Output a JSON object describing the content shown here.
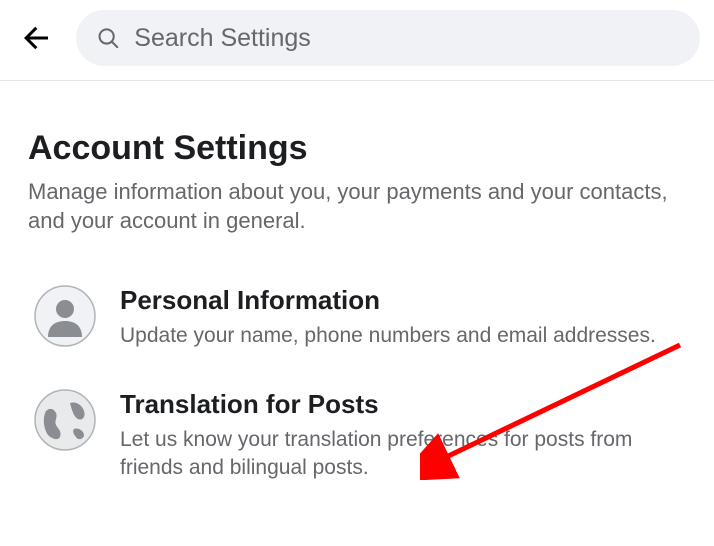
{
  "header": {
    "search_placeholder": "Search Settings"
  },
  "page": {
    "title": "Account Settings",
    "subtitle": "Manage information about you, your payments and your contacts, and your account in general."
  },
  "items": [
    {
      "title": "Personal Information",
      "description": "Update your name, phone numbers and email addresses."
    },
    {
      "title": "Translation for Posts",
      "description": "Let us know your translation preferences for posts from friends and bilingual posts."
    }
  ]
}
